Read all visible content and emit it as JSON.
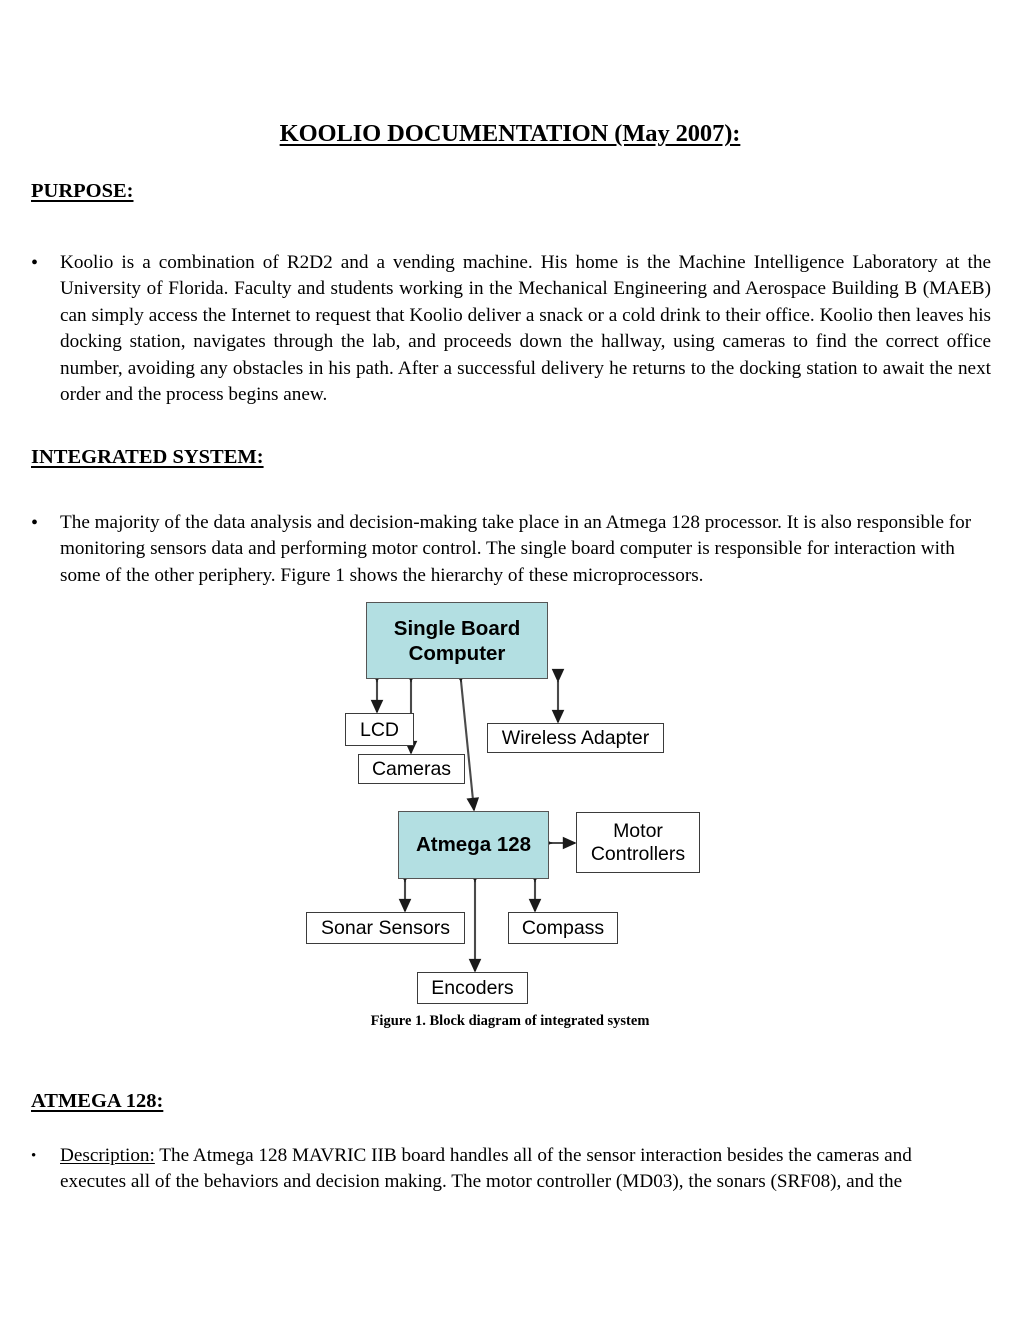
{
  "document": {
    "title": "KOOLIO DOCUMENTATION (May 2007):",
    "sections": [
      {
        "heading": "PURPOSE:",
        "paragraph": "Koolio is a combination of R2D2 and a vending machine.  His home is the Machine Intelligence Laboratory at the University of Florida. Faculty and students working in the Mechanical Engineering and Aerospace Building B (MAEB) can simply access the Internet to request that Koolio deliver a snack or a cold drink to their office. Koolio then leaves his docking station, navigates through the lab, and proceeds down the hallway, using cameras to find the correct office number, avoiding any obstacles in his path. After a successful delivery he returns to the docking station to await the next order and the process begins anew."
      },
      {
        "heading": "INTEGRATED SYSTEM:",
        "paragraph": "The majority of the data analysis and decision-making take place in an Atmega 128 processor.  It is also responsible for monitoring sensors data and performing motor control. The single board computer is responsible for interaction with some of the other periphery. Figure 1 shows the hierarchy of these microprocessors."
      },
      {
        "heading": "ATMEGA 128:",
        "label": "Description:",
        "paragraph": "  The Atmega 128 MAVRIC IIB board handles all of the sensor interaction besides the cameras and executes all of the behaviors and decision making.  The motor controller (MD03), the sonars (SRF08), and the"
      }
    ],
    "bullet_glyph": "•"
  },
  "figure": {
    "caption": "Figure 1. Block diagram of integrated system",
    "highlight_color": "#b3dfe2",
    "border_color": "#3b3b3b",
    "nodes": {
      "sbc": "Single Board\nComputer",
      "lcd": "LCD",
      "cameras": "Cameras",
      "wireless": "Wireless Adapter",
      "atmega": "Atmega 128",
      "motor": "Motor\nControllers",
      "sonar": "Sonar Sensors",
      "compass": "Compass",
      "encoders": "Encoders"
    },
    "connections": [
      {
        "from": "sbc",
        "to": "lcd",
        "type": "bidirectional"
      },
      {
        "from": "sbc",
        "to": "cameras",
        "type": "bidirectional"
      },
      {
        "from": "sbc",
        "to": "atmega",
        "type": "bidirectional"
      },
      {
        "from": "sbc",
        "to": "wireless",
        "type": "bidirectional"
      },
      {
        "from": "atmega",
        "to": "motor",
        "type": "bidirectional"
      },
      {
        "from": "atmega",
        "to": "sonar",
        "type": "bidirectional"
      },
      {
        "from": "atmega",
        "to": "encoders",
        "type": "bidirectional"
      },
      {
        "from": "atmega",
        "to": "compass",
        "type": "bidirectional"
      }
    ]
  }
}
